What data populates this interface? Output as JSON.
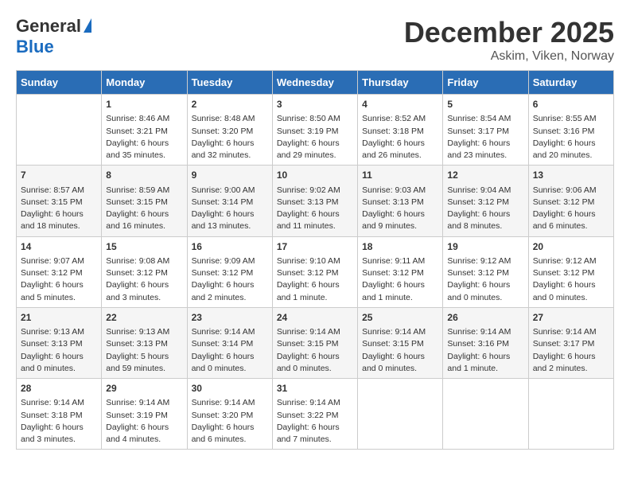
{
  "logo": {
    "general": "General",
    "blue": "Blue"
  },
  "title": "December 2025",
  "subtitle": "Askim, Viken, Norway",
  "weekdays": [
    "Sunday",
    "Monday",
    "Tuesday",
    "Wednesday",
    "Thursday",
    "Friday",
    "Saturday"
  ],
  "weeks": [
    [
      {
        "num": "",
        "info": ""
      },
      {
        "num": "1",
        "info": "Sunrise: 8:46 AM\nSunset: 3:21 PM\nDaylight: 6 hours\nand 35 minutes."
      },
      {
        "num": "2",
        "info": "Sunrise: 8:48 AM\nSunset: 3:20 PM\nDaylight: 6 hours\nand 32 minutes."
      },
      {
        "num": "3",
        "info": "Sunrise: 8:50 AM\nSunset: 3:19 PM\nDaylight: 6 hours\nand 29 minutes."
      },
      {
        "num": "4",
        "info": "Sunrise: 8:52 AM\nSunset: 3:18 PM\nDaylight: 6 hours\nand 26 minutes."
      },
      {
        "num": "5",
        "info": "Sunrise: 8:54 AM\nSunset: 3:17 PM\nDaylight: 6 hours\nand 23 minutes."
      },
      {
        "num": "6",
        "info": "Sunrise: 8:55 AM\nSunset: 3:16 PM\nDaylight: 6 hours\nand 20 minutes."
      }
    ],
    [
      {
        "num": "7",
        "info": "Sunrise: 8:57 AM\nSunset: 3:15 PM\nDaylight: 6 hours\nand 18 minutes."
      },
      {
        "num": "8",
        "info": "Sunrise: 8:59 AM\nSunset: 3:15 PM\nDaylight: 6 hours\nand 16 minutes."
      },
      {
        "num": "9",
        "info": "Sunrise: 9:00 AM\nSunset: 3:14 PM\nDaylight: 6 hours\nand 13 minutes."
      },
      {
        "num": "10",
        "info": "Sunrise: 9:02 AM\nSunset: 3:13 PM\nDaylight: 6 hours\nand 11 minutes."
      },
      {
        "num": "11",
        "info": "Sunrise: 9:03 AM\nSunset: 3:13 PM\nDaylight: 6 hours\nand 9 minutes."
      },
      {
        "num": "12",
        "info": "Sunrise: 9:04 AM\nSunset: 3:12 PM\nDaylight: 6 hours\nand 8 minutes."
      },
      {
        "num": "13",
        "info": "Sunrise: 9:06 AM\nSunset: 3:12 PM\nDaylight: 6 hours\nand 6 minutes."
      }
    ],
    [
      {
        "num": "14",
        "info": "Sunrise: 9:07 AM\nSunset: 3:12 PM\nDaylight: 6 hours\nand 5 minutes."
      },
      {
        "num": "15",
        "info": "Sunrise: 9:08 AM\nSunset: 3:12 PM\nDaylight: 6 hours\nand 3 minutes."
      },
      {
        "num": "16",
        "info": "Sunrise: 9:09 AM\nSunset: 3:12 PM\nDaylight: 6 hours\nand 2 minutes."
      },
      {
        "num": "17",
        "info": "Sunrise: 9:10 AM\nSunset: 3:12 PM\nDaylight: 6 hours\nand 1 minute."
      },
      {
        "num": "18",
        "info": "Sunrise: 9:11 AM\nSunset: 3:12 PM\nDaylight: 6 hours\nand 1 minute."
      },
      {
        "num": "19",
        "info": "Sunrise: 9:12 AM\nSunset: 3:12 PM\nDaylight: 6 hours\nand 0 minutes."
      },
      {
        "num": "20",
        "info": "Sunrise: 9:12 AM\nSunset: 3:12 PM\nDaylight: 6 hours\nand 0 minutes."
      }
    ],
    [
      {
        "num": "21",
        "info": "Sunrise: 9:13 AM\nSunset: 3:13 PM\nDaylight: 6 hours\nand 0 minutes."
      },
      {
        "num": "22",
        "info": "Sunrise: 9:13 AM\nSunset: 3:13 PM\nDaylight: 5 hours\nand 59 minutes."
      },
      {
        "num": "23",
        "info": "Sunrise: 9:14 AM\nSunset: 3:14 PM\nDaylight: 6 hours\nand 0 minutes."
      },
      {
        "num": "24",
        "info": "Sunrise: 9:14 AM\nSunset: 3:15 PM\nDaylight: 6 hours\nand 0 minutes."
      },
      {
        "num": "25",
        "info": "Sunrise: 9:14 AM\nSunset: 3:15 PM\nDaylight: 6 hours\nand 0 minutes."
      },
      {
        "num": "26",
        "info": "Sunrise: 9:14 AM\nSunset: 3:16 PM\nDaylight: 6 hours\nand 1 minute."
      },
      {
        "num": "27",
        "info": "Sunrise: 9:14 AM\nSunset: 3:17 PM\nDaylight: 6 hours\nand 2 minutes."
      }
    ],
    [
      {
        "num": "28",
        "info": "Sunrise: 9:14 AM\nSunset: 3:18 PM\nDaylight: 6 hours\nand 3 minutes."
      },
      {
        "num": "29",
        "info": "Sunrise: 9:14 AM\nSunset: 3:19 PM\nDaylight: 6 hours\nand 4 minutes."
      },
      {
        "num": "30",
        "info": "Sunrise: 9:14 AM\nSunset: 3:20 PM\nDaylight: 6 hours\nand 6 minutes."
      },
      {
        "num": "31",
        "info": "Sunrise: 9:14 AM\nSunset: 3:22 PM\nDaylight: 6 hours\nand 7 minutes."
      },
      {
        "num": "",
        "info": ""
      },
      {
        "num": "",
        "info": ""
      },
      {
        "num": "",
        "info": ""
      }
    ]
  ]
}
